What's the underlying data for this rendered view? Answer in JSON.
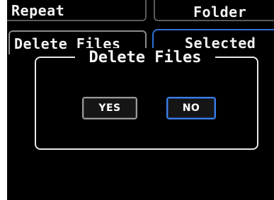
{
  "menu": {
    "row1": {
      "left_label": "Repeat",
      "right_label": "Folder"
    },
    "row2": {
      "left_label": "Delete Files",
      "right_label": "Selected"
    }
  },
  "dialog": {
    "title": "Delete Files",
    "yes_label": "YES",
    "no_label": "NO",
    "selected_button": "NO"
  },
  "colors": {
    "background": "#000000",
    "text": "#f2f2f2",
    "selection_accent": "#2e6fd6",
    "dialog_border": "#e8e8e8"
  }
}
